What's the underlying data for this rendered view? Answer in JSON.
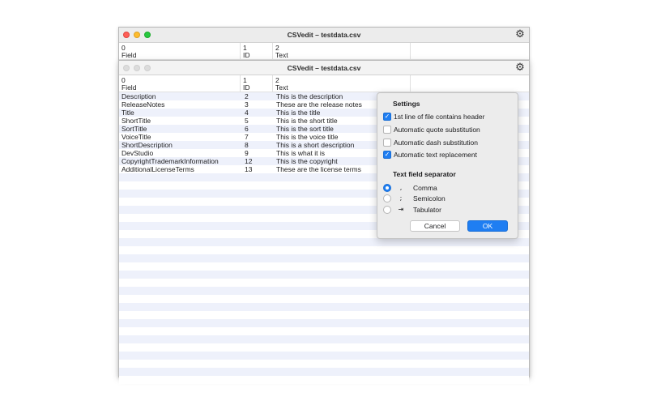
{
  "back_window": {
    "title": "CSVedit – testdata.csv",
    "gear_icon": "gear-icon",
    "columns": [
      {
        "index": "0",
        "name": "Field"
      },
      {
        "index": "1",
        "name": "ID"
      },
      {
        "index": "2",
        "name": "Text"
      }
    ]
  },
  "front_window": {
    "title": "CSVedit – testdata.csv",
    "gear_icon": "gear-icon",
    "columns": [
      {
        "index": "0",
        "name": "Field"
      },
      {
        "index": "1",
        "name": "ID"
      },
      {
        "index": "2",
        "name": "Text"
      }
    ],
    "rows": [
      [
        "Description",
        "2",
        "This is the description"
      ],
      [
        "ReleaseNotes",
        "3",
        "These are the release notes"
      ],
      [
        "Title",
        "4",
        "This is the title"
      ],
      [
        "ShortTitle",
        "5",
        "This is the short title"
      ],
      [
        "SortTitle",
        "6",
        "This is the sort title"
      ],
      [
        "VoiceTitle",
        "7",
        "This is the voice title"
      ],
      [
        "ShortDescription",
        "8",
        "This is a short description"
      ],
      [
        "DevStudio",
        "9",
        "This is what it is"
      ],
      [
        "CopyrightTrademarkInformation",
        "12",
        "This is the copyright"
      ],
      [
        "AdditionalLicenseTerms",
        "13",
        "These are the license terms"
      ]
    ]
  },
  "settings": {
    "title": "Settings",
    "options": [
      {
        "label": "1st line of file contains header",
        "checked": true
      },
      {
        "label": "Automatic quote substitution",
        "checked": false
      },
      {
        "label": "Automatic dash substitution",
        "checked": false
      },
      {
        "label": "Automatic text replacement",
        "checked": true
      }
    ],
    "separator_title": "Text field separator",
    "separators": [
      {
        "symbol": ",",
        "label": "Comma",
        "selected": true
      },
      {
        "symbol": ";",
        "label": "Semicolon",
        "selected": false
      },
      {
        "symbol": "⇥",
        "label": "Tabulator",
        "selected": false
      }
    ],
    "cancel_label": "Cancel",
    "ok_label": "OK"
  },
  "colors": {
    "accent": "#1f7ef2",
    "row_stripe": "#eef1fb"
  }
}
